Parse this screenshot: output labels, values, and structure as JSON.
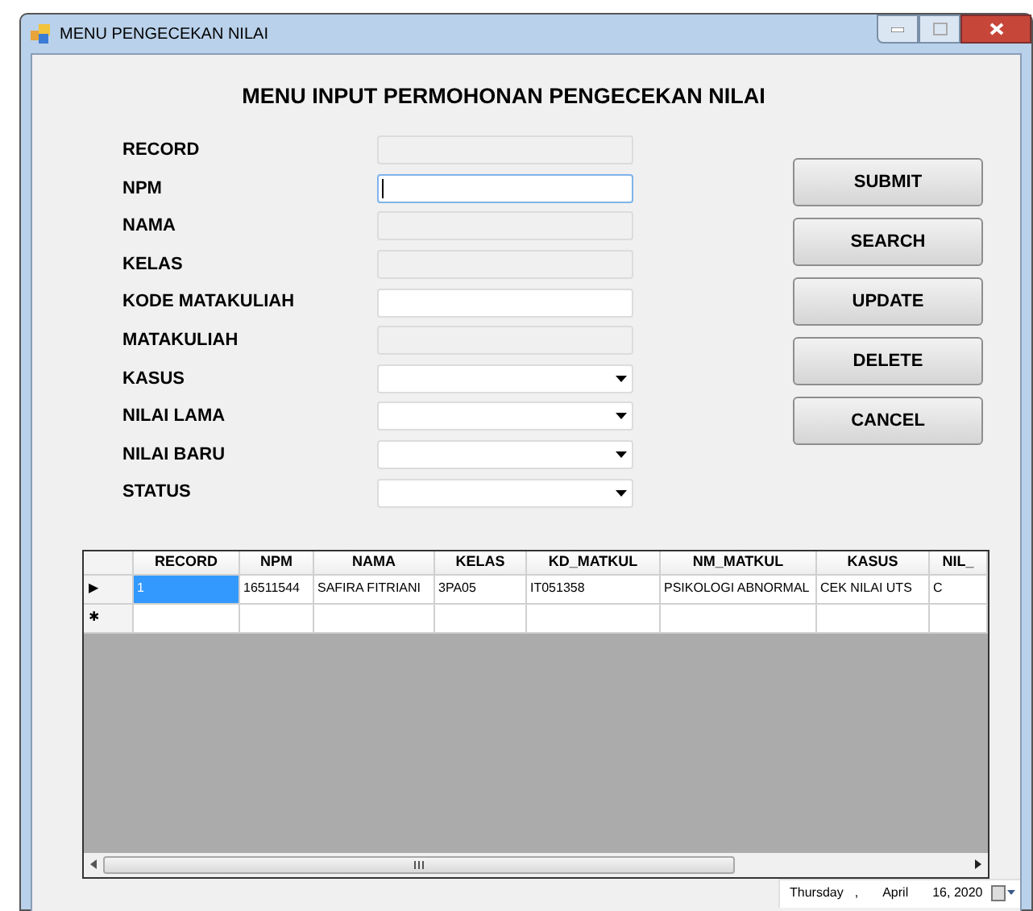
{
  "window": {
    "title": "MENU PENGECEKAN NILAI"
  },
  "heading": "MENU INPUT PERMOHONAN PENGECEKAN NILAI",
  "fields": [
    {
      "label": "RECORD",
      "kind": "readonly",
      "focused": false
    },
    {
      "label": "NPM",
      "kind": "text",
      "focused": true
    },
    {
      "label": "NAMA",
      "kind": "readonly",
      "focused": false
    },
    {
      "label": "KELAS",
      "kind": "readonly",
      "focused": false
    },
    {
      "label": "KODE MATAKULIAH",
      "kind": "text",
      "focused": false
    },
    {
      "label": "MATAKULIAH",
      "kind": "readonly",
      "focused": false
    },
    {
      "label": "KASUS",
      "kind": "combo",
      "focused": false
    },
    {
      "label": "NILAI LAMA",
      "kind": "combo",
      "focused": false
    },
    {
      "label": "NILAI BARU",
      "kind": "combo",
      "focused": false
    },
    {
      "label": "STATUS",
      "kind": "combo",
      "focused": false
    }
  ],
  "buttons": [
    "SUBMIT",
    "SEARCH",
    "UPDATE",
    "DELETE",
    "CANCEL"
  ],
  "table": {
    "columns": [
      "RECORD",
      "NPM",
      "NAMA",
      "KELAS",
      "KD_MATKUL",
      "NM_MATKUL",
      "KASUS",
      "NIL_"
    ],
    "rows": [
      {
        "marker": "▶",
        "current": true,
        "cells": [
          "1",
          "16511544",
          "SAFIRA FITRIANI",
          "3PA05",
          "IT051358",
          "PSIKOLOGI ABNORMAL",
          "CEK NILAI UTS",
          "C"
        ]
      },
      {
        "marker": "✱",
        "current": false,
        "cells": [
          "",
          "",
          "",
          "",
          "",
          "",
          "",
          ""
        ]
      }
    ]
  },
  "date_picker": {
    "day": "Thursday",
    "separator": ",",
    "month": "April",
    "date": "16, 2020"
  }
}
